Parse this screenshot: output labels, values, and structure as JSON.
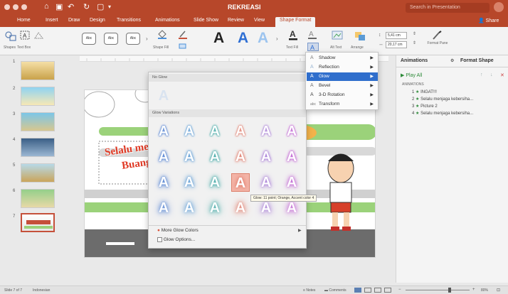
{
  "window": {
    "title": "REKREASI"
  },
  "search": {
    "placeholder": "Search in Presentation"
  },
  "tabs": [
    "Home",
    "Insert",
    "Draw",
    "Design",
    "Transitions",
    "Animations",
    "Slide Show",
    "Review",
    "View",
    "Shape Format"
  ],
  "active_tab": "Shape Format",
  "share_label": "Share",
  "ribbon": {
    "shapes_label": "Shapes",
    "textbox_label": "Text Box",
    "style_samples": [
      "Abc",
      "Abc",
      "Abc"
    ],
    "shape_fill_label": "Shape Fill",
    "wordart_letter": "A",
    "text_fill_label": "Text Fill",
    "alt_text_label": "Alt Text",
    "arrange_label": "Arrange",
    "height_value": "5,41 cm",
    "width_value": "20,17 cm",
    "format_pane_label": "Format Pane"
  },
  "effects_menu": {
    "items": [
      {
        "label": "Shadow",
        "icon": "A"
      },
      {
        "label": "Reflection",
        "icon": "A"
      },
      {
        "label": "Glow",
        "icon": "A"
      },
      {
        "label": "Bevel",
        "icon": "A"
      },
      {
        "label": "3-D Rotation",
        "icon": "A"
      },
      {
        "label": "Transform",
        "icon": "abc"
      }
    ],
    "active": "Glow"
  },
  "glow_gallery": {
    "no_glow_label": "No Glow",
    "variations_label": "Glow Variations",
    "letter": "A",
    "colors": [
      "#4e7fd2",
      "#5b9bd5",
      "#3aa6a3",
      "#e07b6a",
      "#a77bd6",
      "#c060d3"
    ],
    "highlighted": {
      "row": 2,
      "col": 3
    },
    "more_colors_label": "More Glow Colors",
    "options_label": "Glow Options..."
  },
  "tooltip": "Glow: 11 point; Orange, Accent color 4",
  "thumbnails": [
    {
      "num": "1"
    },
    {
      "num": "2"
    },
    {
      "num": "3"
    },
    {
      "num": "4"
    },
    {
      "num": "5"
    },
    {
      "num": "6"
    },
    {
      "num": "7"
    }
  ],
  "selected_slide": "7",
  "slide": {
    "title_line1": "Selalu menj",
    "title_line2": "Buang"
  },
  "panel": {
    "tab_animations": "Animations",
    "tab_format": "Format Shape",
    "play_all": "Play All",
    "section_label": "ANIMATIONS",
    "rows": [
      {
        "num": "1",
        "label": "INGAT!!!"
      },
      {
        "num": "2",
        "label": "Selalu menjaga kebersiha..."
      },
      {
        "num": "3",
        "label": "Picture 2"
      },
      {
        "num": "4",
        "label": "Selalu menjaga kebersiha..."
      }
    ]
  },
  "status": {
    "slide_info": "Slide 7 of 7",
    "language": "Indonesian",
    "notes": "Notes",
    "comments": "Comments",
    "zoom": "80%"
  }
}
